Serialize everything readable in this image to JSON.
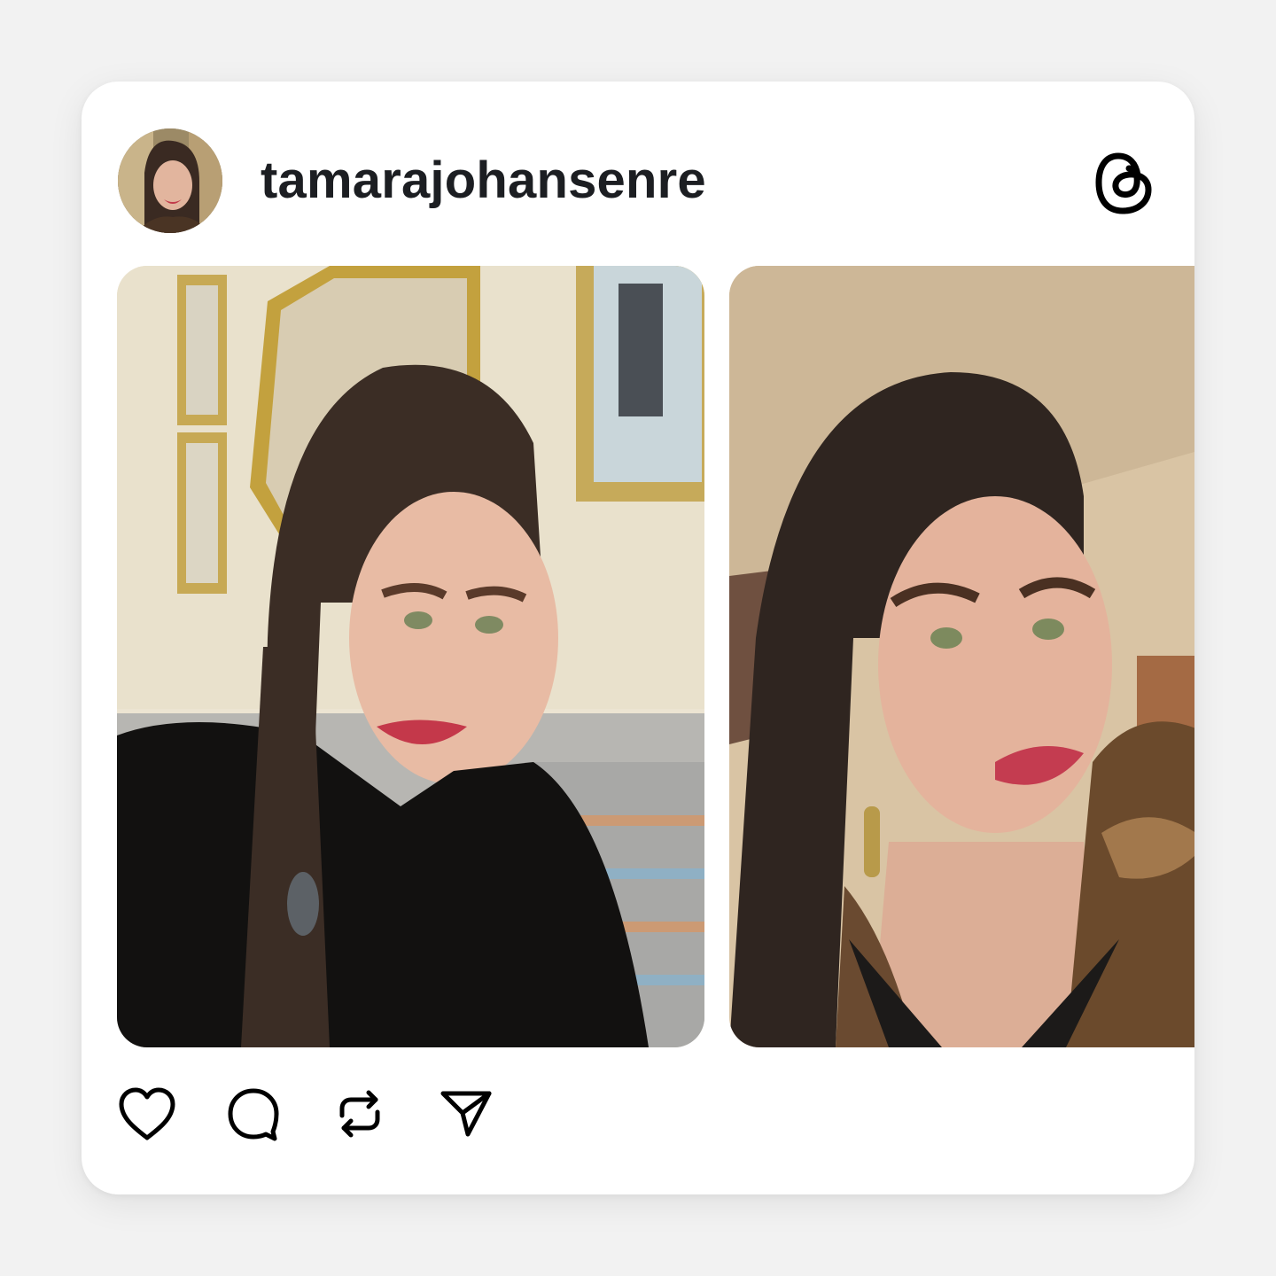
{
  "post": {
    "username": "tamarajohansenre",
    "avatar_icon": "profile-avatar",
    "platform_logo": "threads-logo-icon"
  },
  "gallery": {
    "images": [
      {
        "name": "selfie-black-sweater",
        "description_icon": "photo"
      },
      {
        "name": "selfie-fur-jacket",
        "description_icon": "photo"
      }
    ]
  },
  "actions": [
    {
      "name": "like-button",
      "icon": "heart-icon"
    },
    {
      "name": "reply-button",
      "icon": "comment-icon"
    },
    {
      "name": "repost-button",
      "icon": "repost-icon"
    },
    {
      "name": "share-button",
      "icon": "send-icon"
    }
  ],
  "colors": {
    "background": "#f2f2f2",
    "card": "#ffffff",
    "text": "#1c1e22",
    "icon": "#000000"
  }
}
